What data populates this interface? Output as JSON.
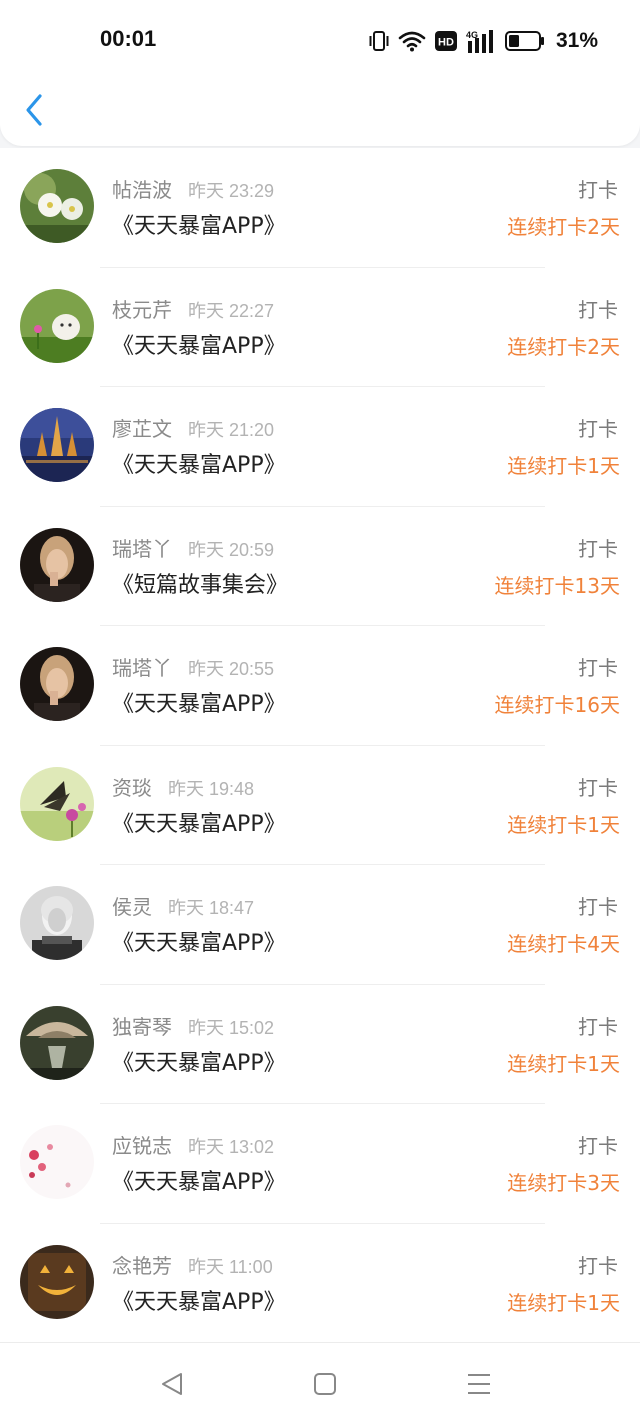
{
  "status_bar": {
    "time": "00:01",
    "battery_percent": "31%",
    "network_label": "4G",
    "hd_label": "HD",
    "icons": [
      "vibrate-icon",
      "wifi-icon",
      "hd-icon",
      "signal-icon",
      "battery-icon"
    ]
  },
  "header": {
    "back_icon": "chevron-left-icon"
  },
  "entries": [
    {
      "name": "帖浩波",
      "time": "昨天 23:29",
      "book": "《天天暴富APP》",
      "action": "打卡",
      "streak": "连续打卡2天"
    },
    {
      "name": "枝元芹",
      "time": "昨天 22:27",
      "book": "《天天暴富APP》",
      "action": "打卡",
      "streak": "连续打卡2天"
    },
    {
      "name": "廖芷文",
      "time": "昨天 21:20",
      "book": "《天天暴富APP》",
      "action": "打卡",
      "streak": "连续打卡1天"
    },
    {
      "name": "瑞塔丫",
      "time": "昨天 20:59",
      "book": "《短篇故事集会》",
      "action": "打卡",
      "streak": "连续打卡13天"
    },
    {
      "name": "瑞塔丫",
      "time": "昨天 20:55",
      "book": "《天天暴富APP》",
      "action": "打卡",
      "streak": "连续打卡16天"
    },
    {
      "name": "资琰",
      "time": "昨天 19:48",
      "book": "《天天暴富APP》",
      "action": "打卡",
      "streak": "连续打卡1天"
    },
    {
      "name": "侯灵",
      "time": "昨天 18:47",
      "book": "《天天暴富APP》",
      "action": "打卡",
      "streak": "连续打卡4天"
    },
    {
      "name": "独寄琴",
      "time": "昨天 15:02",
      "book": "《天天暴富APP》",
      "action": "打卡",
      "streak": "连续打卡1天"
    },
    {
      "name": "应锐志",
      "time": "昨天 13:02",
      "book": "《天天暴富APP》",
      "action": "打卡",
      "streak": "连续打卡3天"
    },
    {
      "name": "念艳芳",
      "time": "昨天 11:00",
      "book": "《天天暴富APP》",
      "action": "打卡",
      "streak": "连续打卡1天"
    }
  ],
  "colors": {
    "accent_blue": "#2b95e9",
    "streak_orange": "#f0823a",
    "name_gray": "#8a8a8a",
    "book_text": "#222222"
  },
  "nav_bar": {
    "icons": [
      "back-triangle-icon",
      "home-square-icon",
      "menu-lines-icon"
    ]
  }
}
